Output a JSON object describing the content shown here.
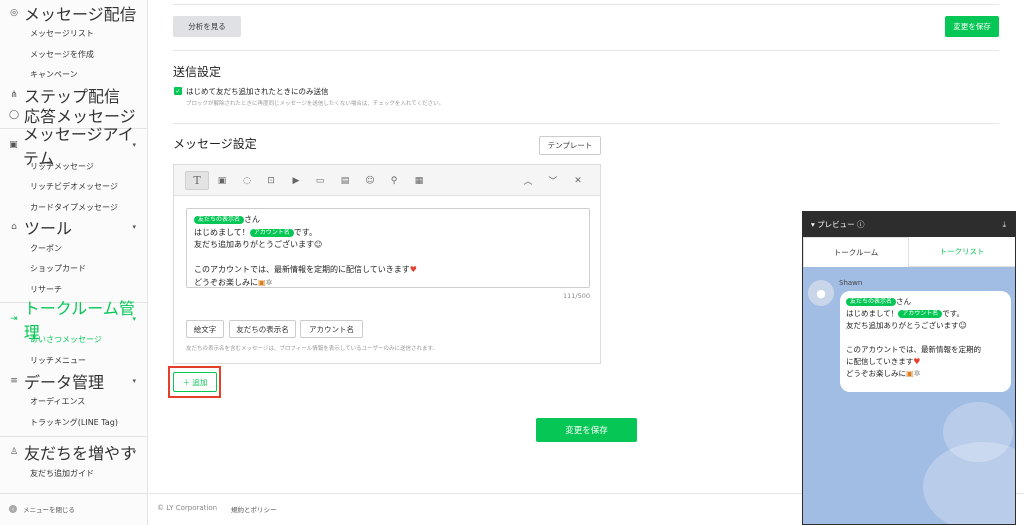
{
  "sidebar": {
    "groups": [
      {
        "label": "メッセージ配信",
        "icon": "broadcast-icon",
        "caret": "▾",
        "items": [
          "メッセージリスト",
          "メッセージを作成",
          "キャンペーン"
        ]
      },
      {
        "label": "ステップ配信",
        "icon": "step-icon"
      },
      {
        "label": "応答メッセージ",
        "icon": "chat-icon"
      },
      {
        "label": "メッセージアイテム",
        "icon": "message-item-icon",
        "caret": "▾",
        "items": [
          "リッチメッセージ",
          "リッチビデオメッセージ",
          "カードタイプメッセージ"
        ]
      },
      {
        "label": "ツール",
        "icon": "tool-icon",
        "caret": "▾",
        "items": [
          "クーポン",
          "ショップカード",
          "リサーチ"
        ]
      },
      {
        "label": "トークルーム管理",
        "icon": "talkroom-icon",
        "caret": "▾",
        "items": [
          "あいさつメッセージ",
          "リッチメニュー"
        ]
      },
      {
        "label": "データ管理",
        "icon": "database-icon",
        "caret": "▾",
        "items": [
          "オーディエンス",
          "トラッキング(LINE Tag)"
        ]
      },
      {
        "label": "友だちを増やす",
        "icon": "add-friend-icon",
        "caret": "▾",
        "items": [
          "友だち追加ガイド"
        ]
      }
    ],
    "close_menu": "メニューを閉じる",
    "close_icon": "‹"
  },
  "main": {
    "analyze_button": "分析を見る",
    "save_top": "変更を保存",
    "send_settings_title": "送信設定",
    "checkbox_label": "はじめて友だち追加されたときにのみ送信",
    "checkbox_hint": "ブロックが解除されたときに再度同じメッセージを送信したくない場合は、チェックを入れてください。",
    "message_settings_title": "メッセージ設定",
    "template_button": "テンプレート",
    "editor": {
      "line1_tag": "友だちの表示名",
      "line1_after": "さん",
      "line2_before": "はじめまして！",
      "line2_tag": "アカウント名",
      "line2_after": "です。",
      "line3": "友だち追加ありがとうございます",
      "line5": "このアカウントでは、最新情報を定期的に配信していきます",
      "line6": "どうぞお楽しみに",
      "counter": "111/500",
      "chips": [
        "絵文字",
        "友だちの表示名",
        "アカウント名"
      ],
      "hint": "友だちの表示名を含むメッセージは、プロフィール情報を表示しているユーザーのみに送信されます。"
    },
    "add_button": "＋ 追加",
    "save_bottom": "変更を保存"
  },
  "footer": {
    "copyright": "© LY Corporation",
    "policy": "規約とポリシー"
  },
  "preview": {
    "title": "▾ プレビュー ⓘ",
    "download_icon": "⤓",
    "tabs": [
      "トークルーム",
      "トークリスト"
    ],
    "sender": "Shawn",
    "bubble": {
      "line1_tag": "友だちの表示名",
      "line1_after": "さん",
      "line2_before": "はじめまして！",
      "line2_tag": "アカウント名",
      "line2_after": "です。",
      "line3": "友だち追加ありがとうございます",
      "line5a": "このアカウントでは、最新情報を定期的",
      "line5b": "に配信していきます",
      "line6": "どうぞお楽しみに"
    }
  },
  "colors": {
    "accent": "#06c755",
    "highlight_box": "#e53f2b",
    "preview_bg": "#a2bde3"
  }
}
